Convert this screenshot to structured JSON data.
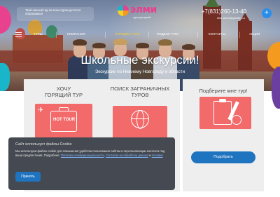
{
  "topbar": {
    "search_text": "Твой личный гид по всем турам детского образования",
    "logo_word": "элми",
    "logo_sub": "туры для детей",
    "phone": "+7(831)260-13-40",
    "email": "elmi-travel@yandex.ru",
    "telegram_icon": "telegram-icon"
  },
  "nav": {
    "items": [
      {
        "label": "Туры"
      },
      {
        "label": "Компания"
      },
      {
        "label": "Горящие туры"
      },
      {
        "label": "Подбор тура"
      },
      {
        "label": "Контакты"
      },
      {
        "label": "Акции"
      }
    ]
  },
  "hero": {
    "title": "Школьные экскурсии!",
    "subtitle": "Экскурсии по Нижнему Новгороду и области"
  },
  "cards": [
    {
      "heading": "ХОЧУ\nГОРЯЩИЙ ТУР",
      "illustration_label": "HOT TOUR"
    },
    {
      "heading": "ПОИСК ЗАГРАНИЧНЫХ\nТУРОВ"
    },
    {
      "heading": "Подберите мне тур!",
      "button_label": "Подобрать"
    }
  ],
  "cookie": {
    "title": "Сайт использует файлы Cookie",
    "body_prefix": "Мы используем файлы cookie для повышения удобства пользования сайтом и персонализации контента под ваши предпочтения.",
    "body_more": "Подробнее:",
    "link1": "Политика конфиденциальности",
    "link_sep": ",",
    "link2": "Согласие на обработку данных",
    "link_and": "и",
    "link3": "Условия",
    "accept_label": "Принять"
  },
  "colors": {
    "accent_blue": "#1f74c0",
    "brand_pink": "#e8428e",
    "card_illustration": "#f26a6a",
    "cookie_bg": "#454a52"
  }
}
